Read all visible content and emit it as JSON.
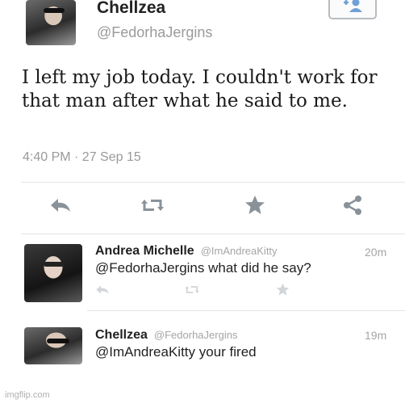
{
  "tweet": {
    "author_name": "Chellzea",
    "author_handle": "@FedorhaJergins",
    "text": "I left my job today. I couldn't work for that man after what he said to me.",
    "timestamp": "4:40 PM · 27 Sep 15",
    "follow_icon": "add-user-icon",
    "actions": [
      "reply-icon",
      "retweet-icon",
      "favorite-icon",
      "share-icon"
    ]
  },
  "replies": [
    {
      "author_name": "Andrea Michelle",
      "author_handle": "@ImAndreaKitty",
      "text": "@FedorhaJergins what did he say?",
      "time": "20m"
    },
    {
      "author_name": "Chellzea",
      "author_handle": "@FedorhaJergins",
      "text": "@ImAndreaKitty your fired",
      "time": "19m"
    }
  ],
  "watermark": "imgflip.com",
  "colors": {
    "text": "#222222",
    "muted": "#9a9a9a",
    "icon": "#8a9299"
  }
}
